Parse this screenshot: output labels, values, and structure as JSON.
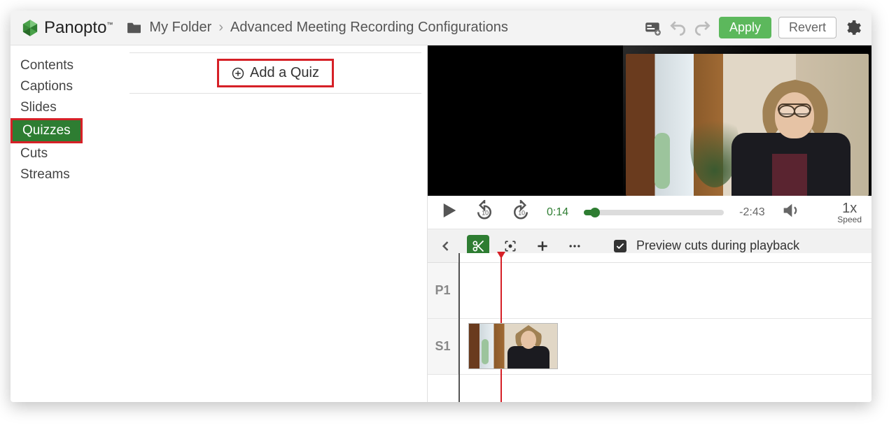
{
  "brand": {
    "name": "Panopto"
  },
  "breadcrumb": {
    "folder_label": "My Folder",
    "session_title": "Advanced Meeting Recording Configurations"
  },
  "topbar": {
    "apply_label": "Apply",
    "revert_label": "Revert"
  },
  "sidebar": {
    "items": [
      {
        "label": "Contents",
        "selected": false
      },
      {
        "label": "Captions",
        "selected": false
      },
      {
        "label": "Slides",
        "selected": false
      },
      {
        "label": "Quizzes",
        "selected": true
      },
      {
        "label": "Cuts",
        "selected": false
      },
      {
        "label": "Streams",
        "selected": false
      }
    ]
  },
  "center": {
    "add_quiz_label": "Add a Quiz"
  },
  "playback": {
    "current_time": "0:14",
    "remaining_time": "-2:43",
    "speed_value": "1x",
    "speed_label": "Speed",
    "progress_percent": 8
  },
  "toolbar": {
    "preview_cuts_label": "Preview cuts during playback",
    "preview_cuts_checked": true
  },
  "timeline": {
    "tracks": [
      {
        "name": "P1"
      },
      {
        "name": "S1"
      }
    ]
  },
  "colors": {
    "accent_green": "#2e7d32",
    "highlight_red": "#d62027"
  }
}
